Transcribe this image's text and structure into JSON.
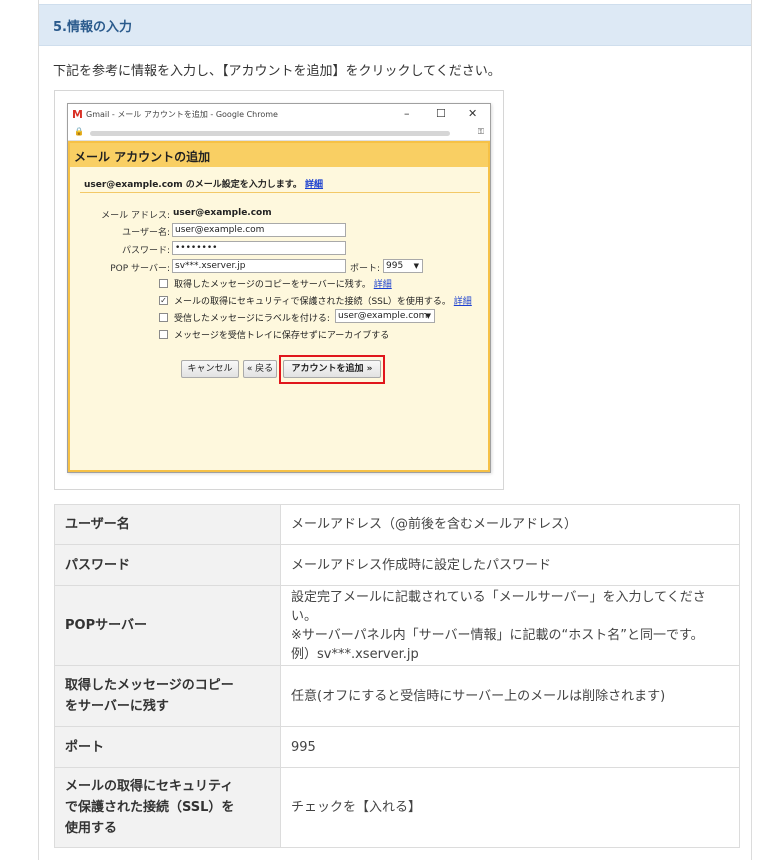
{
  "section": {
    "title": "5.情報の入力"
  },
  "intro": "下記を参考に情報を入力し、【アカウントを追加】をクリックしてください。",
  "window": {
    "gmail_mark": "M",
    "title": "Gmail - メール アカウントを追加 - Google Chrome",
    "controls": [
      "–",
      "☐",
      "✕"
    ]
  },
  "dialog": {
    "heading": "メール アカウントの追加",
    "subtitle": "user@example.com のメール設定を入力します。",
    "subtitle_link": "詳細",
    "email_label": "メール アドレス:",
    "email_value": "user@example.com",
    "username_label": "ユーザー名:",
    "username_value": "user@example.com",
    "password_label": "パスワード:",
    "password_value": "••••••••",
    "pop_label": "POP サーバー:",
    "pop_value": "sv***.xserver.jp",
    "port_label": "ポート:",
    "port_value": "995",
    "opt1": "取得したメッセージのコピーをサーバーに残す。",
    "opt1_link": "詳細",
    "opt2": "メールの取得にセキュリティで保護された接続（SSL）を使用する。",
    "opt2_link": "詳細",
    "opt3": "受信したメッセージにラベルを付ける:",
    "opt3_value": "user@example.com",
    "opt4": "メッセージを受信トレイに保存せずにアーカイブする",
    "cancel": "キャンセル",
    "back": "« 戻る",
    "add": "アカウントを追加 »"
  },
  "table": [
    {
      "label": [
        "ユーザー名"
      ],
      "value": [
        "メールアドレス（@前後を含むメールアドレス）"
      ]
    },
    {
      "label": [
        "パスワード"
      ],
      "value": [
        "メールアドレス作成時に設定したパスワード"
      ]
    },
    {
      "label": [
        "POPサーバー"
      ],
      "value": [
        "設定完了メールに記載されている「メールサーバー」を入力してください。",
        "※サーバーパネル内「サーバー情報」に記載の“ホスト名”と同一です。",
        "例）sv***.xserver.jp"
      ]
    },
    {
      "label": [
        "取得したメッセージのコピー",
        "をサーバーに残す"
      ],
      "value": [
        "任意(オフにすると受信時にサーバー上のメールは削除されます)"
      ]
    },
    {
      "label": [
        "ポート"
      ],
      "value": [
        "995"
      ]
    },
    {
      "label": [
        "メールの取得にセキュリティ",
        "で保護された接続（SSL）を",
        "使用する"
      ],
      "value": [
        "チェックを【入れる】"
      ]
    }
  ]
}
